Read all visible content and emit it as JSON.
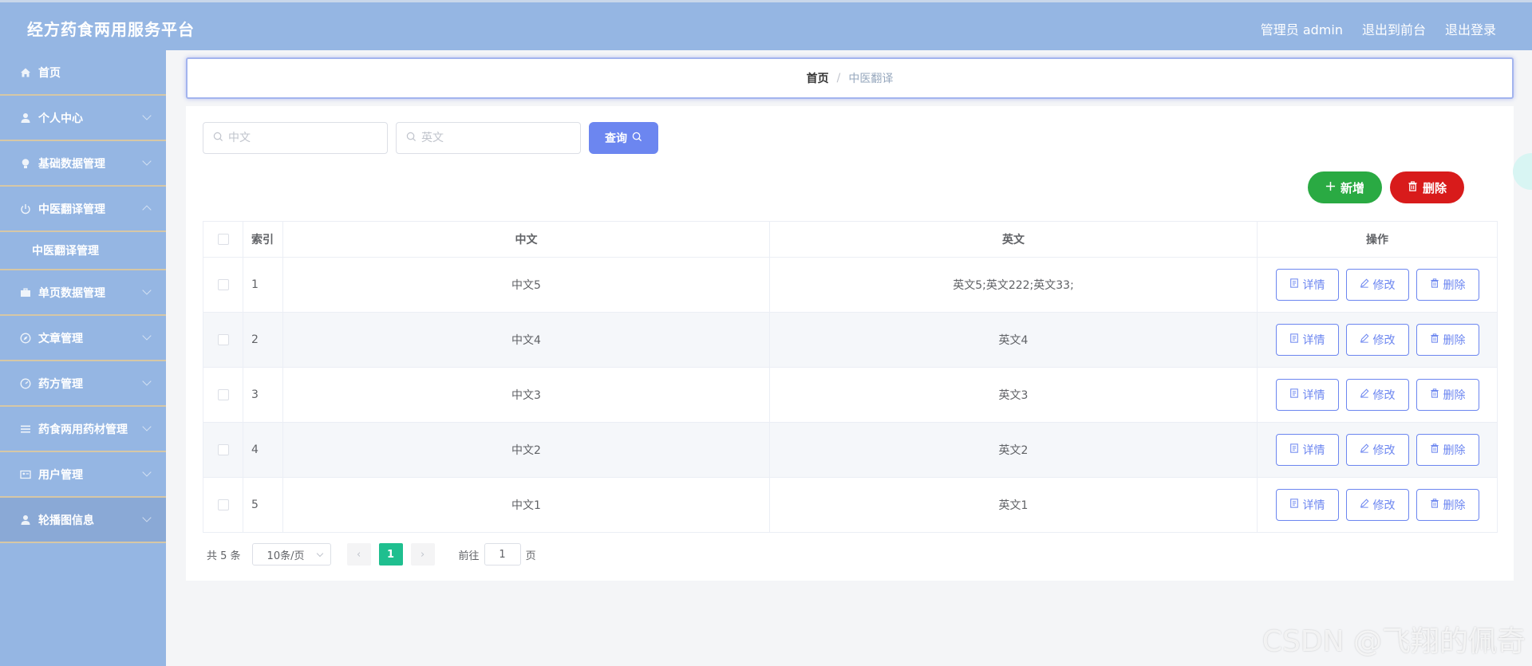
{
  "header": {
    "title": "经方药食两用服务平台",
    "user": "管理员 admin",
    "to_front": "退出到前台",
    "logout": "退出登录"
  },
  "sidebar": {
    "items": [
      {
        "label": "首页",
        "icon": "home-icon"
      },
      {
        "label": "个人中心",
        "icon": "user-icon"
      },
      {
        "label": "基础数据管理",
        "icon": "bulb-icon"
      },
      {
        "label": "中医翻译管理",
        "icon": "power-icon"
      },
      {
        "label": "单页数据管理",
        "icon": "briefcase-icon"
      },
      {
        "label": "文章管理",
        "icon": "compass-icon"
      },
      {
        "label": "药方管理",
        "icon": "gauge-icon"
      },
      {
        "label": "药食两用药材管理",
        "icon": "list-icon"
      },
      {
        "label": "用户管理",
        "icon": "card-icon"
      },
      {
        "label": "轮播图信息",
        "icon": "user-icon"
      }
    ],
    "submenu_label": "中医翻译管理"
  },
  "breadcrumb": {
    "home": "首页",
    "separator": "/",
    "current": "中医翻译"
  },
  "search": {
    "zh_placeholder": "中文",
    "en_placeholder": "英文",
    "query_label": "查询"
  },
  "actions": {
    "add_label": "新增",
    "delete_label": "删除"
  },
  "table": {
    "headers": {
      "index": "索引",
      "zh": "中文",
      "en": "英文",
      "ops": "操作"
    },
    "rows": [
      {
        "index": "1",
        "zh": "中文5",
        "en": "英文5;英文222;英文33;"
      },
      {
        "index": "2",
        "zh": "中文4",
        "en": "英文4"
      },
      {
        "index": "3",
        "zh": "中文3",
        "en": "英文3"
      },
      {
        "index": "4",
        "zh": "中文2",
        "en": "英文2"
      },
      {
        "index": "5",
        "zh": "中文1",
        "en": "英文1"
      }
    ],
    "row_ops": {
      "detail": "详情",
      "edit": "修改",
      "delete": "删除"
    }
  },
  "pagination": {
    "total": "共 5 条",
    "page_size": "10条/页",
    "current_page": "1",
    "goto_label": "前往",
    "goto_value": "1",
    "page_suffix": "页"
  },
  "watermark": "CSDN @飞翔的佩奇",
  "colors": {
    "header_bg": "#95b6e3",
    "primary": "#6c86f0",
    "add_btn": "#2aaa43",
    "delete_btn": "#d81b1b",
    "active_page": "#1fbf8f"
  }
}
